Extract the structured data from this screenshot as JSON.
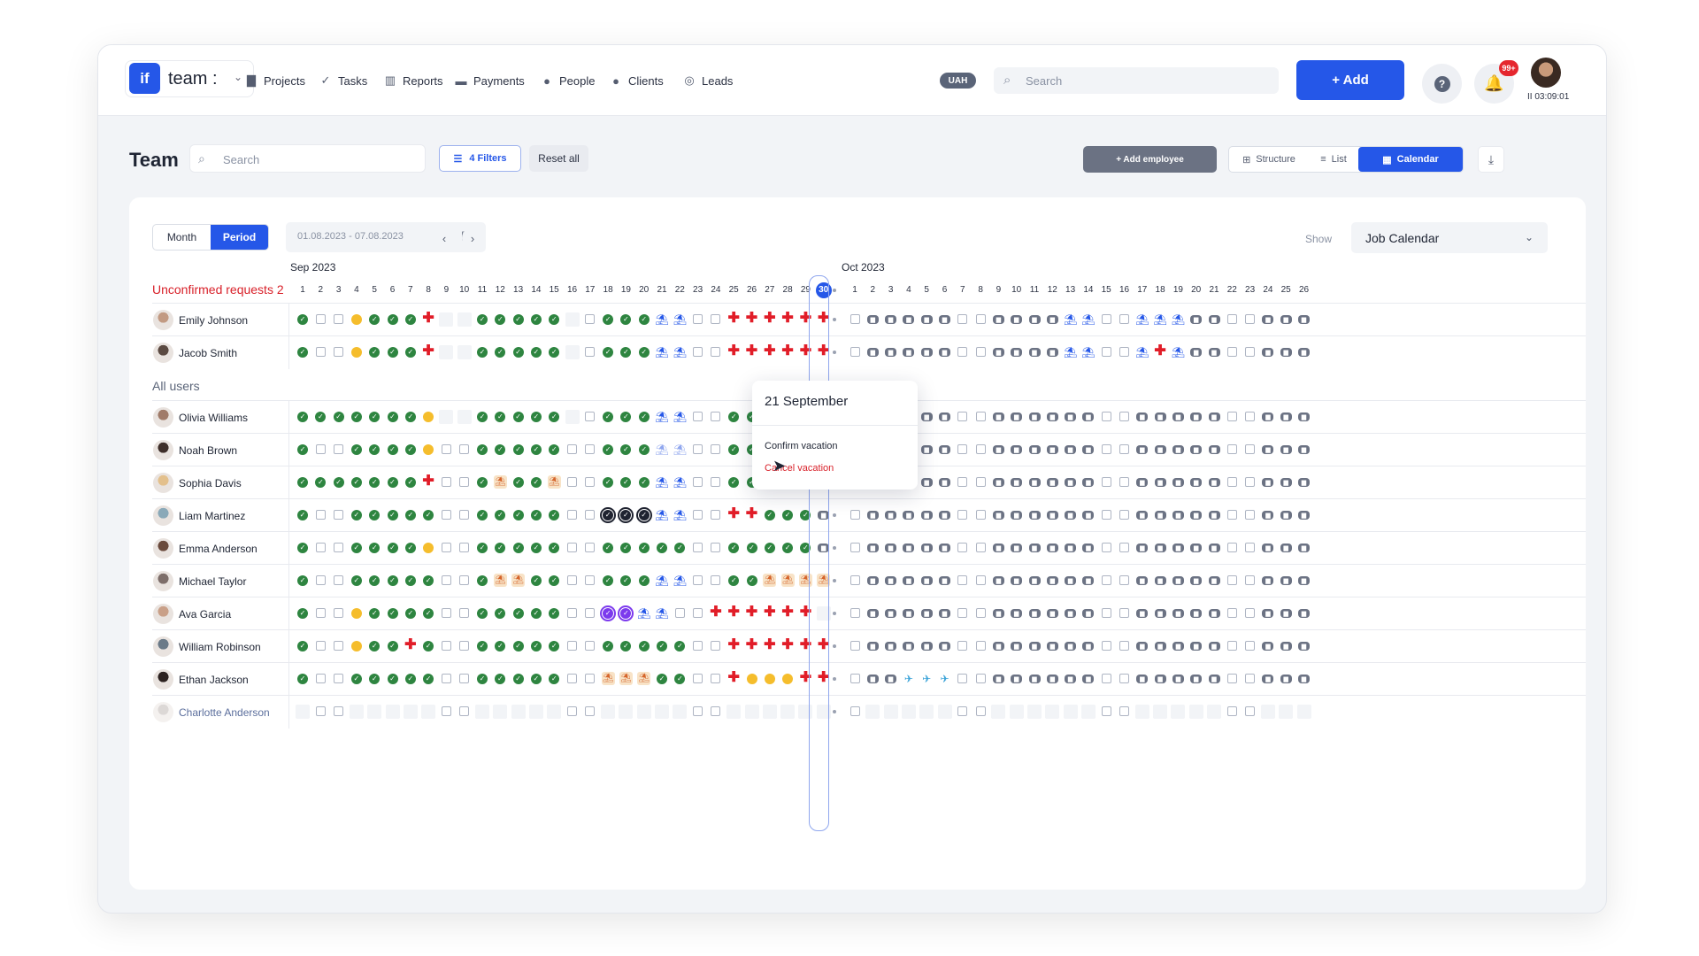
{
  "app": {
    "logo": "if",
    "workspace": "team :"
  },
  "nav": [
    {
      "label": "Projects",
      "icon": "file-icon",
      "glyph": "▇"
    },
    {
      "label": "Tasks",
      "icon": "check-circle-icon",
      "glyph": "✓"
    },
    {
      "label": "Reports",
      "icon": "chart-icon",
      "glyph": "▥"
    },
    {
      "label": "Payments",
      "icon": "card-icon",
      "glyph": "▬"
    },
    {
      "label": "People",
      "icon": "person-icon",
      "glyph": "●"
    },
    {
      "label": "Clients",
      "icon": "people-icon",
      "glyph": "●"
    },
    {
      "label": "Leads",
      "icon": "leads-icon",
      "glyph": "◎"
    }
  ],
  "header": {
    "currency": "UAH",
    "search_placeholder": "Search",
    "add_label": "+ Add",
    "help": "?",
    "notifications": "99+",
    "timer": "II 03:09:01"
  },
  "page": {
    "title": "Team",
    "search_placeholder": "Search",
    "filters_label": "4 Filters",
    "reset_label": "Reset all",
    "add_employee_label": "+ Add employee",
    "views": [
      "Structure",
      "List",
      "Calendar"
    ],
    "active_view": "Calendar"
  },
  "toolbar": {
    "modes": [
      "Month",
      "Period"
    ],
    "active_mode": "Period",
    "date_range": "01.08.2023 - 07.08.2023",
    "show_label": "Show",
    "show_value": "Job Calendar"
  },
  "calendar": {
    "months": [
      "Sep 2023",
      "Oct 2023"
    ],
    "sep_days": [
      "1",
      "2",
      "3",
      "4",
      "5",
      "6",
      "7",
      "8",
      "9",
      "10",
      "11",
      "12",
      "13",
      "14",
      "15",
      "16",
      "17",
      "18",
      "19",
      "20",
      "21",
      "22",
      "23",
      "24",
      "25",
      "26",
      "27",
      "28",
      "29",
      "30"
    ],
    "oct_days": [
      "1",
      "2",
      "3",
      "4",
      "5",
      "6",
      "7",
      "8",
      "9",
      "10",
      "11",
      "12",
      "13",
      "14",
      "15",
      "16",
      "17",
      "18",
      "19",
      "20",
      "21",
      "22",
      "23",
      "24",
      "25",
      "26"
    ],
    "today": "30",
    "unconfirmed_label": "Unconfirmed requests 2",
    "all_users_label": "All users",
    "legend": {
      "O": "worked-day",
      "W": "weekend",
      "B": "no-data",
      "S": "sick-leave",
      "H": "half-day",
      "V": "vacation",
      "P": "vacation-pending",
      "E": "vacation-beach",
      "F": "planned-work",
      "T": "business-trip",
      "K": "confirmed-selected",
      "U": "confirmed-purple"
    },
    "unconfirmed": [
      {
        "name": "Emily Johnson",
        "sep": "OWWHOOOSBBOOOOOBWOOOVVWWSSSSSS",
        "oct": "WFFFFFWWFFFFVVWWVVVFFWWFFF"
      },
      {
        "name": "Jacob Smith",
        "sep": "OWWHOOOSBBOOOOOBWOOOVVWWSSSSSS",
        "oct": "WFFFFFWWFFFFVVWWVSVFFWWFFF"
      }
    ],
    "users": [
      {
        "name": "Olivia Williams",
        "sep": "OOOOOOOHBBOOOOOBWOOOVVWWOOOOOF",
        "oct": "WFFFFFWWFFFFFFWWFFFFFWWFFF"
      },
      {
        "name": "Noah Brown",
        "sep": "OWWOOOOHWWOOOOOWWOOOPPWWOOOHHF",
        "oct": "WFFFFFWWFFFFFFWWFFFFFWWFFF"
      },
      {
        "name": "Sophia Davis",
        "sep": "OOOOOOOSWWOEOOEWWOOOVVWWOOOOOF",
        "oct": "WFFFFFWWFFFFFFWWFFFFFWWFFF"
      },
      {
        "name": "Liam Martinez",
        "sep": "OWWOOOOOWWOOOOOWWKKKVVWWSSOOOF",
        "oct": "WFFFFFWWFFFFFFWWFFFFFWWFFF"
      },
      {
        "name": "Emma Anderson",
        "sep": "OWWOOOOHWWOOOOOWWOOOOOWWOOOOOF",
        "oct": "WFFFFFWWFFFFFFWWFFFFFWWFFF"
      },
      {
        "name": "Michael Taylor",
        "sep": "OWWOOOOOWWOEEOOWWOOOVVWWOOEEEE",
        "oct": "WFFFFFWWFFFFFFWWFFFFFWWFFF"
      },
      {
        "name": "Ava Garcia",
        "sep": "OWWHOOOOWWOOOOOWWUUVVWWSSSSSSB",
        "oct": "WFFFFFWWFFFFFFWWFFFFFWWFFF"
      },
      {
        "name": "William Robinson",
        "sep": "OWWHOOSOWWOOOOOWWOOOOOWWSSSSSS",
        "oct": "WFFFFFWWFFFFFFWWFFFFFWWFFF"
      },
      {
        "name": "Ethan Jackson",
        "sep": "OWWOOOOOWWOOOOOWWEEEOOWWSHHHSS",
        "oct": "WFFTTTWWFFFFFFWWFFFFFWWFFF"
      },
      {
        "name": "Charlotte Anderson",
        "sep": "BWWBBBBBWWBBBBBWWBBBBBWWBBBBBB",
        "oct": "WBBBBBWWBBBBBBWWBBBBBWWBBB"
      }
    ]
  },
  "popup": {
    "date": "21 September",
    "confirm_label": "Confirm vacation",
    "cancel_label": "Cancel vacation"
  },
  "colors": {
    "accent": "#2557e8",
    "worked": "#2e8540",
    "sick": "#e11d28",
    "half": "#f5bd2c",
    "unconfirmed": "#d81f28"
  }
}
